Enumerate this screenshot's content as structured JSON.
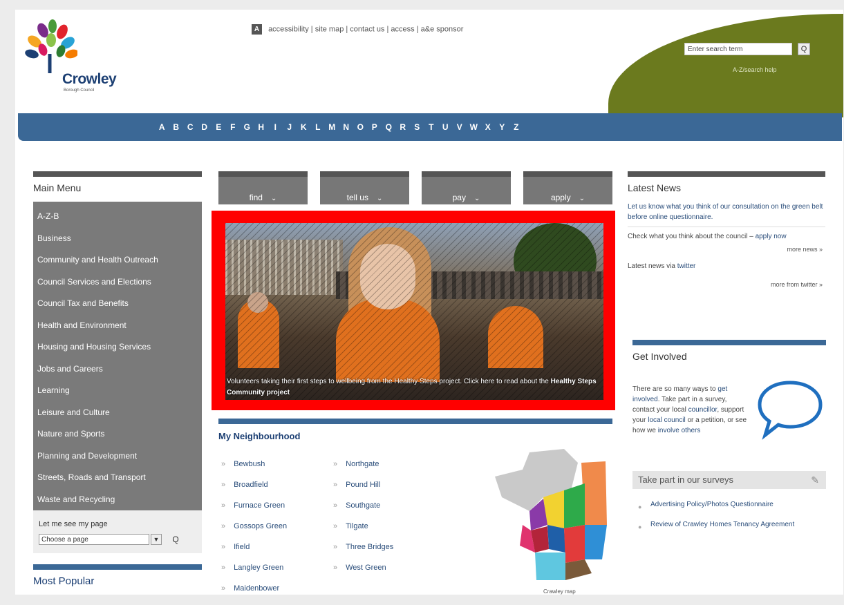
{
  "header": {
    "logo_name": "Crowley",
    "logo_sub": "Borough Council",
    "a_icon": "A",
    "top_links": [
      "accessibility",
      "site map",
      "contact us",
      "access",
      "a&e sponsor"
    ],
    "search_placeholder": "Enter search term",
    "search_button": "Q",
    "header_link": "A-Z/search help"
  },
  "az_letters": [
    "A",
    "B",
    "C",
    "D",
    "E",
    "F",
    "G",
    "H",
    "I",
    "J",
    "K",
    "L",
    "M",
    "N",
    "O",
    "P",
    "Q",
    "R",
    "S",
    "T",
    "U",
    "V",
    "W",
    "X",
    "Y",
    "Z"
  ],
  "left": {
    "title": "Main Menu",
    "menu": [
      "A-Z-B",
      "Business",
      "Community and Health Outreach",
      "Council Services and Elections",
      "Council Tax and Benefits",
      "Health and Environment",
      "Housing and Housing Services",
      "Jobs and Careers",
      "Learning",
      "Leisure and Culture",
      "Nature and Sports",
      "Planning and Development",
      "Streets, Roads and Transport",
      "Waste and Recycling"
    ],
    "mypage_label": "Let me see my page",
    "mypage_select": "Choose a page",
    "mypage_go": "Q",
    "most_popular_title": "Most Popular"
  },
  "tabs": [
    {
      "label": "find",
      "chev": "⌄"
    },
    {
      "label": "tell us",
      "chev": "⌄"
    },
    {
      "label": "pay",
      "chev": "⌄"
    },
    {
      "label": "apply",
      "chev": "⌄"
    }
  ],
  "hero": {
    "caption": "Volunteers taking their first steps to wellbeing from the Healthy Steps project. Click here to read about the",
    "caption_link": "Healthy Steps Community project"
  },
  "neighbourhood": {
    "title": "My Neighbourhood",
    "col1": [
      "Bewbush",
      "Broadfield",
      "Furnace Green",
      "Gossops Green",
      "Ifield",
      "Langley Green",
      "Maidenbower"
    ],
    "col2": [
      "Northgate",
      "Pound Hill",
      "Southgate",
      "Tilgate",
      "Three Bridges",
      "West Green"
    ],
    "map_label": "Crawley map"
  },
  "right": {
    "title": "Latest News",
    "news1": "Let us know what you think of our consultation on the green belt before online questionnaire.",
    "news2_text": "Check what you think about the council –",
    "news2_link": "apply now",
    "more_news": "more news »",
    "news3_text": "Latest news via",
    "news3_link": "twitter",
    "more_twitter": "more from twitter »"
  },
  "get_involved": {
    "title": "Get Involved",
    "text_a": "There are so many ways to",
    "link_a": "get involved",
    "text_b": ". Take part in a survey, contact your local",
    "link_b": "councillor",
    "text_c": ", support your",
    "link_c": "local council",
    "text_d": "or a petition, or see how we",
    "link_d": "involve others",
    "survey_title": "Take part in our surveys",
    "survey_icon": "✎",
    "surveys": [
      "Advertising Policy/Photos Questionnaire",
      "Review of Crawley Homes Tenancy Agreement"
    ]
  }
}
